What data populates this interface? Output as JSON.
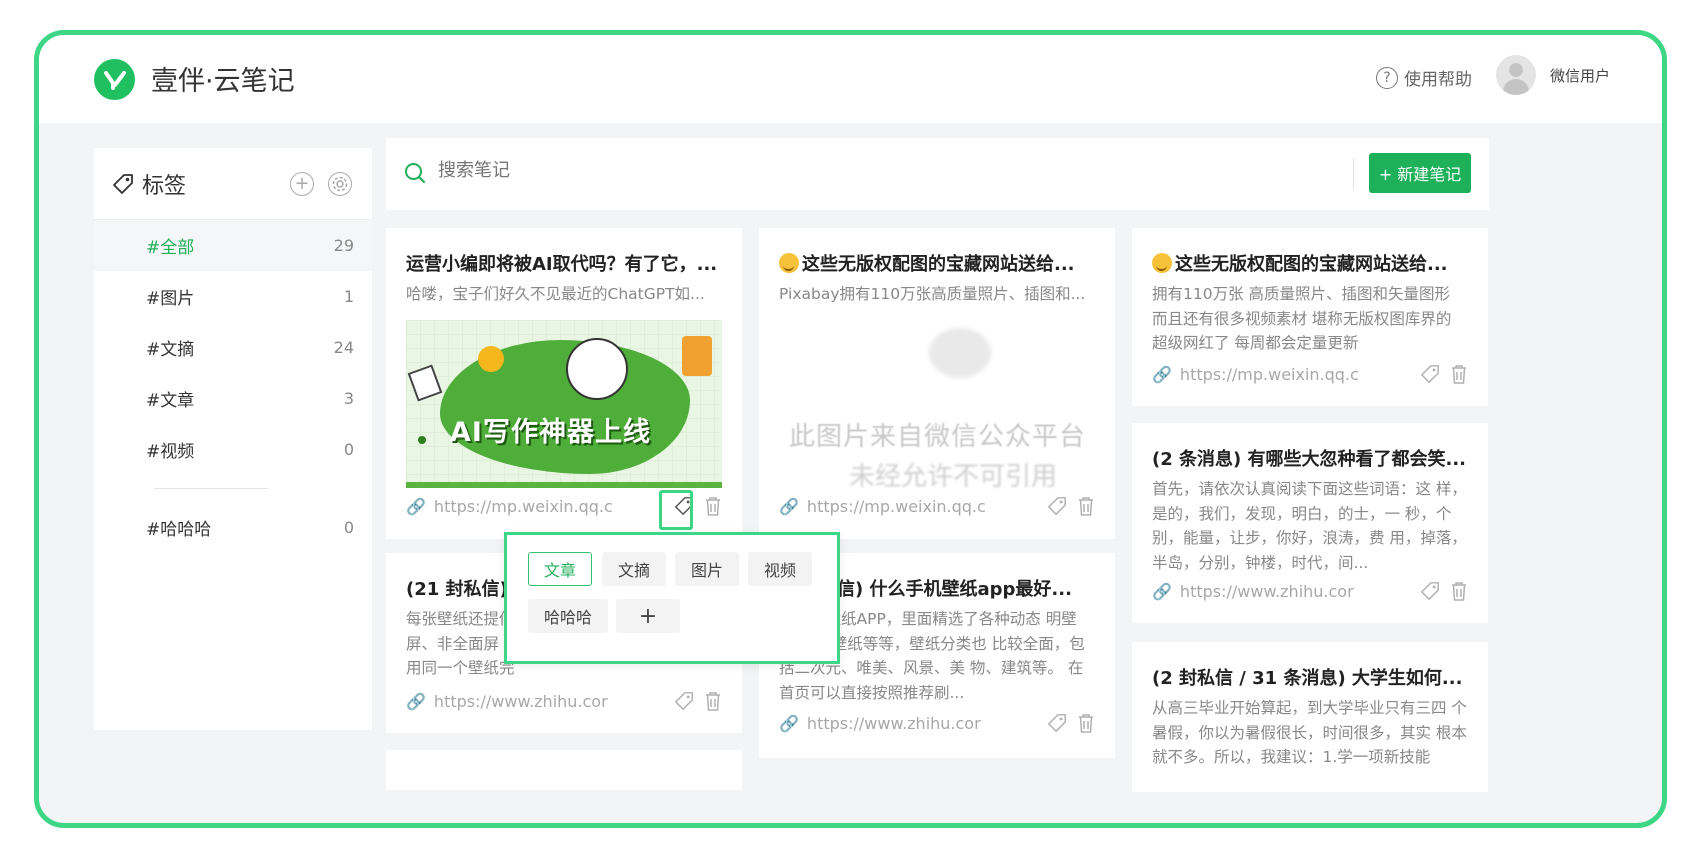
{
  "app": {
    "title": "壹伴·云笔记",
    "logo_letter": "Y"
  },
  "header": {
    "help_label": "使用帮助",
    "user_name": "微信用户"
  },
  "sidebar": {
    "title": "标签",
    "tags": [
      {
        "label": "#全部",
        "count": "29",
        "active": true
      },
      {
        "label": "#图片",
        "count": "1"
      },
      {
        "label": "#文摘",
        "count": "24"
      },
      {
        "label": "#文章",
        "count": "3"
      },
      {
        "label": "#视频",
        "count": "0"
      }
    ],
    "custom_tags": [
      {
        "label": "#哈哈哈",
        "count": "0"
      }
    ]
  },
  "search": {
    "placeholder": "搜索笔记"
  },
  "new_note_label": "+ 新建笔记",
  "notes": [
    {
      "title": "运营小编即将被AI取代吗？有了它，...",
      "desc": "哈喽，宝子们好久不见最近的ChatGPT如...",
      "image_text": "AI写作神器上线",
      "link": "https://mp.weixin.qq.c"
    },
    {
      "title": "(21 封私信)",
      "desc": "每张壁纸还提供 屏、非全面屏 备用同一个壁纸完全没问题。",
      "link": "https://www.zhihu.cor"
    },
    {
      "title": "这些无版权配图的宝藏网站送给...",
      "desc": "Pixabay拥有110万张高质量照片、插图和...",
      "watermark_1": "此图片来自微信公众平台",
      "watermark_2": "未经允许不可引用",
      "link": "https://mp.weixin.qq.c"
    },
    {
      "title": "私信) 什么手机壁纸app最好...",
      "desc": "高质量壁纸APP，里面精选了各种动态 明壁纸、3D壁纸等等，壁纸分类也 比较全面，包括二次元、唯美、风景、美 物、建筑等。 在首页可以直接按照推荐刷...",
      "link": "https://www.zhihu.cor"
    },
    {
      "title": "这些无版权配图的宝藏网站送给...",
      "desc": "拥有110万张 高质量照片、插图和矢量图形 而且还有很多视频素材 堪称无版权图库界的 超级网红了 每周都会定量更新",
      "link": "https://mp.weixin.qq.c"
    },
    {
      "title": "(2 条消息) 有哪些大忽种看了都会笑...",
      "desc": "首先，请依次认真阅读下面这些词语：这 样，是的，我们，发现，明白，的士，一 秒，个别，能量，让步，你好，浪涛，费 用，掉落，半岛，分别，钟楼，时代，间...",
      "link": "https://www.zhihu.cor"
    },
    {
      "title": "(2 封私信 / 31 条消息) 大学生如何...",
      "desc": "从高三毕业开始算起，到大学毕业只有三四 个暑假，你以为暑假很长，时间很多，其实 根本就不多。所以，我建议：1.学一项新技能"
    }
  ],
  "tag_popup": {
    "chips": [
      "文章",
      "文摘",
      "图片",
      "视频",
      "哈哈哈"
    ],
    "selected": "文章",
    "add": "+"
  },
  "colors": {
    "brand_green": "#1fb05a",
    "highlight": "#3dd684"
  }
}
